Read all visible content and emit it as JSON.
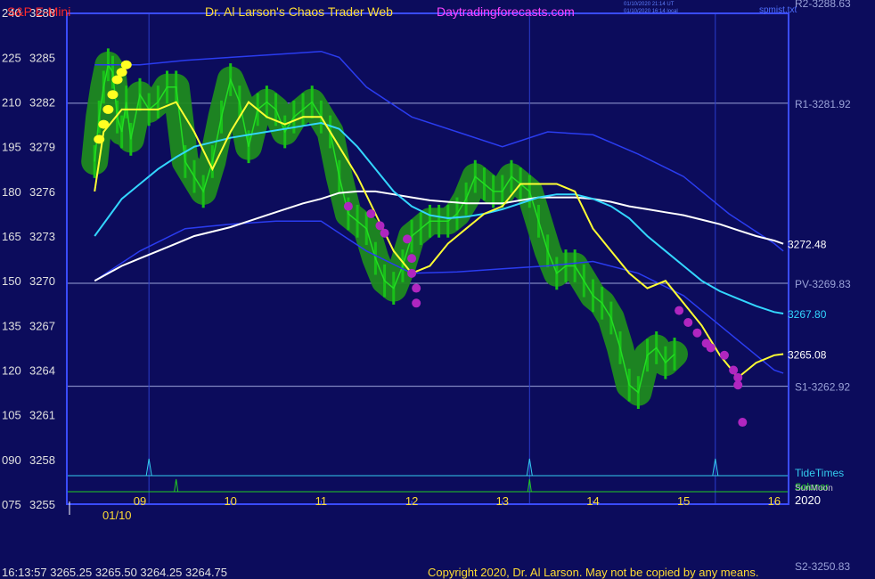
{
  "header": {
    "symbol": "S&P E-Mini",
    "title": "Dr. Al Larson's Chaos Trader Web",
    "site": "Daytradingforecasts.com",
    "stamp1": "01/10/2020 21:14 UT",
    "stamp2": "01/10/2020 16:14 local",
    "file": "spmist.txt"
  },
  "footer": {
    "quote": "16:13:57  3265.25  3265.50  3264.25  3264.75",
    "copyright": "Copyright 2020, Dr. Al Larson. May not be copied by any means.",
    "year": "2020",
    "s2": "S2-3250.83"
  },
  "colors": {
    "background": "#0c0c5c",
    "frame": "#3a4cff",
    "price": "#19c019",
    "band": "#1f8a1f",
    "yellow_ma": "#ffff33",
    "cyan_ma": "#33d6ff",
    "white_ma": "#ffffff",
    "envelope": "#2a3cf0",
    "pivot_line": "#9aa2d8",
    "axis_text": "#e0e0e0",
    "time_text": "#ffdd33",
    "magenta": "#b026c0"
  },
  "chart_data": {
    "type": "line",
    "title": "S&P E-Mini",
    "y_axis_left": {
      "ticks_index": [
        "240",
        "225",
        "210",
        "195",
        "180",
        "165",
        "150",
        "135",
        "120",
        "105",
        "090",
        "075"
      ],
      "ticks_price": [
        3288,
        3285,
        3282,
        3279,
        3276,
        3273,
        3270,
        3267,
        3264,
        3261,
        3258,
        3255
      ],
      "ylim": [
        3255,
        3288
      ]
    },
    "x_axis": {
      "ticks": [
        "09",
        "10",
        "11",
        "12",
        "13",
        "14",
        "15",
        "16"
      ],
      "date_label": "01/10"
    },
    "levels": [
      {
        "name": "R2",
        "label": "R2-3288.63",
        "value": 3288.63
      },
      {
        "name": "R1",
        "label": "R1-3281.92",
        "value": 3281.92
      },
      {
        "name": "PV",
        "label": "PV-3269.83",
        "value": 3269.83
      },
      {
        "name": "S1",
        "label": "S1-3262.92",
        "value": 3262.92
      },
      {
        "name": "S2",
        "label": "S2-3250.83",
        "value": 3250.83
      }
    ],
    "last_values": {
      "white": "3272.48",
      "cyan": "3267.80",
      "yellow": "3265.08"
    },
    "series": {
      "price": {
        "x": [
          8.5,
          8.55,
          8.6,
          8.65,
          8.7,
          8.75,
          8.8,
          8.85,
          8.9,
          9.0,
          9.1,
          9.2,
          9.3,
          9.4,
          9.5,
          9.6,
          9.7,
          9.8,
          9.9,
          10.0,
          10.1,
          10.2,
          10.3,
          10.4,
          10.5,
          10.6,
          10.7,
          10.8,
          10.9,
          11.0,
          11.1,
          11.2,
          11.3,
          11.4,
          11.5,
          11.6,
          11.7,
          11.8,
          11.9,
          12.0,
          12.1,
          12.2,
          12.3,
          12.4,
          12.5,
          12.6,
          12.7,
          12.8,
          12.9,
          13.0,
          13.1,
          13.2,
          13.3,
          13.4,
          13.5,
          13.6,
          13.7,
          13.8,
          13.9,
          14.0,
          14.1,
          14.2,
          14.3,
          14.4,
          14.5,
          14.6,
          14.7,
          14.8,
          14.9,
          15.0,
          15.1,
          15.2,
          15.3,
          15.4,
          15.5,
          15.6,
          15.7,
          15.8,
          15.9,
          16.0,
          16.1
        ],
        "values": [
          3278,
          3281,
          3283,
          3284.5,
          3284,
          3281,
          3280,
          3282,
          3279.5,
          3282.5,
          3281.5,
          3282,
          3283,
          3283,
          3278,
          3277,
          3276,
          3278,
          3281,
          3283.5,
          3282,
          3279,
          3281.5,
          3282,
          3281.5,
          3280,
          3281,
          3281.5,
          3282,
          3281,
          3280,
          3277,
          3274.5,
          3274,
          3273.5,
          3271.5,
          3270,
          3269.5,
          3271,
          3273,
          3273.5,
          3274,
          3274,
          3274,
          3274.5,
          3275.5,
          3277,
          3276.5,
          3276,
          3276,
          3277,
          3276.5,
          3276,
          3274,
          3272,
          3270.5,
          3271,
          3271,
          3270,
          3269,
          3268.5,
          3267.5,
          3265.5,
          3263,
          3262.5,
          3265,
          3265.5,
          3264.5,
          3265.08
        ]
      },
      "yellow": {
        "name": "yellow",
        "x": [
          8.5,
          8.6,
          8.8,
          9.0,
          9.2,
          9.4,
          9.6,
          9.8,
          10.0,
          10.2,
          10.4,
          10.6,
          10.8,
          11.0,
          11.2,
          11.4,
          11.6,
          11.8,
          12.0,
          12.2,
          12.4,
          12.6,
          12.8,
          13.0,
          13.2,
          13.4,
          13.6,
          13.8,
          14.0,
          14.2,
          14.4,
          14.6,
          14.8,
          15.0,
          15.2,
          15.4,
          15.6,
          15.8,
          16.0,
          16.1
        ],
        "values": [
          3276,
          3280,
          3281.5,
          3281.5,
          3281.5,
          3282,
          3280,
          3277.5,
          3280,
          3282,
          3281,
          3280.5,
          3281,
          3281,
          3279,
          3277,
          3274.5,
          3272,
          3270.5,
          3271,
          3272.5,
          3273.5,
          3274.5,
          3275,
          3276.5,
          3276.5,
          3276.5,
          3276,
          3273.5,
          3272,
          3270.5,
          3269.5,
          3270,
          3268.5,
          3267,
          3265,
          3263.5,
          3264.5,
          3265,
          3265.08
        ]
      },
      "cyan": {
        "name": "cyan",
        "x": [
          8.5,
          8.8,
          9.0,
          9.2,
          9.4,
          9.6,
          9.8,
          10.0,
          10.2,
          10.4,
          10.6,
          10.8,
          11.0,
          11.2,
          11.4,
          11.6,
          11.8,
          12.0,
          12.2,
          12.4,
          12.6,
          12.8,
          13.0,
          13.2,
          13.4,
          13.6,
          13.8,
          14.0,
          14.2,
          14.4,
          14.6,
          14.8,
          15.0,
          15.2,
          15.4,
          15.6,
          15.8,
          16.0,
          16.1
        ],
        "values": [
          3273,
          3275.5,
          3276.5,
          3277.5,
          3278.3,
          3279,
          3279.3,
          3279.6,
          3279.8,
          3280,
          3280.2,
          3280.4,
          3280.6,
          3280.2,
          3279,
          3277.5,
          3276,
          3275,
          3274.4,
          3274.2,
          3274.3,
          3274.5,
          3274.8,
          3275.2,
          3275.6,
          3275.8,
          3275.8,
          3275.5,
          3275,
          3274.2,
          3273,
          3272,
          3271,
          3270,
          3269.3,
          3268.8,
          3268.3,
          3267.9,
          3267.8
        ]
      },
      "white": {
        "name": "white",
        "x": [
          8.5,
          8.8,
          9.0,
          9.2,
          9.4,
          9.6,
          9.8,
          10.0,
          10.2,
          10.4,
          10.6,
          10.8,
          11.0,
          11.2,
          11.4,
          11.6,
          11.8,
          12.0,
          12.2,
          12.4,
          12.6,
          12.8,
          13.0,
          13.2,
          13.4,
          13.6,
          13.8,
          14.0,
          14.2,
          14.4,
          14.6,
          14.8,
          15.0,
          15.2,
          15.4,
          15.6,
          15.8,
          16.0,
          16.1
        ],
        "values": [
          3270,
          3271,
          3271.5,
          3272,
          3272.5,
          3273,
          3273.3,
          3273.6,
          3274,
          3274.4,
          3274.8,
          3275.2,
          3275.5,
          3275.9,
          3276,
          3276,
          3275.8,
          3275.6,
          3275.4,
          3275.3,
          3275.2,
          3275.2,
          3275.2,
          3275.4,
          3275.6,
          3275.6,
          3275.6,
          3275.5,
          3275.3,
          3275,
          3274.8,
          3274.6,
          3274.4,
          3274.1,
          3273.8,
          3273.4,
          3273,
          3272.7,
          3272.48
        ]
      },
      "env_upper": {
        "x": [
          8.5,
          9.0,
          9.5,
          10.0,
          10.5,
          11.0,
          11.2,
          11.5,
          12.0,
          12.5,
          13.0,
          13.5,
          14.0,
          14.5,
          15.0,
          15.5,
          16.0,
          16.1
        ],
        "values": [
          3284.5,
          3284.5,
          3284.8,
          3285,
          3285.2,
          3285.4,
          3285,
          3283,
          3281,
          3280,
          3279,
          3280,
          3279.8,
          3278.5,
          3277,
          3274.5,
          3272.5,
          3272
        ]
      },
      "env_lower": {
        "x": [
          8.5,
          9.0,
          9.5,
          10.0,
          10.5,
          11.0,
          11.5,
          12.0,
          12.5,
          13.0,
          13.5,
          14.0,
          14.5,
          15.0,
          15.5,
          16.0,
          16.1
        ],
        "values": [
          3270,
          3272,
          3273.5,
          3273.8,
          3274,
          3274,
          3272,
          3270.5,
          3270.6,
          3270.8,
          3271,
          3271.3,
          3270.5,
          3269,
          3266.5,
          3264,
          3263.8
        ]
      },
      "yellow_dots": {
        "x": [
          8.55,
          8.6,
          8.65,
          8.7,
          8.75,
          8.8,
          8.85
        ],
        "values": [
          3279.5,
          3280.5,
          3281.5,
          3282.5,
          3283.5,
          3284,
          3284.5
        ]
      },
      "magenta_dots": {
        "x": [
          11.3,
          11.55,
          11.65,
          11.7,
          11.95,
          12.0,
          12.0,
          12.05,
          12.05,
          14.95,
          15.05,
          15.15,
          15.25,
          15.3,
          15.45,
          15.55,
          15.6,
          15.6,
          15.65
        ],
        "values": [
          3275,
          3274.5,
          3273.7,
          3273.2,
          3272.8,
          3271.5,
          3270.5,
          3269.5,
          3268.5,
          3268,
          3267.2,
          3266.5,
          3265.8,
          3265.5,
          3265,
          3264,
          3263.5,
          3263,
          3260.5
        ]
      }
    },
    "lower_panel": {
      "labels": [
        "TideTimes",
        "Solunar",
        "SunMoon"
      ],
      "cyan_spikes": [
        9.1,
        13.3,
        15.35
      ],
      "green_spikes": [
        9.4,
        13.3
      ]
    }
  }
}
